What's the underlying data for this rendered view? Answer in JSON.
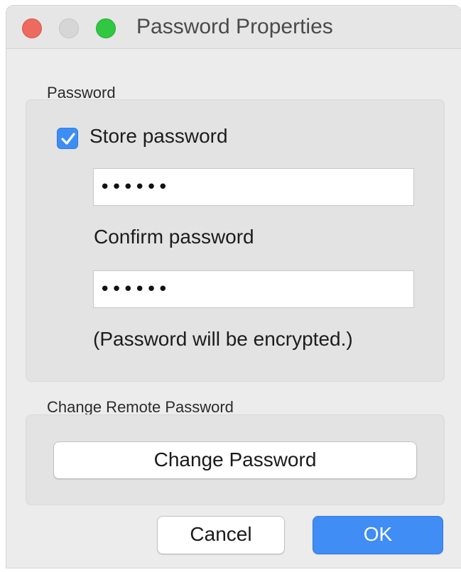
{
  "window": {
    "title": "Password Properties"
  },
  "password_group": {
    "label": "Password",
    "store_password": {
      "label": "Store password",
      "checked": true
    },
    "password_field": {
      "value": "••••••"
    },
    "confirm_label": "Confirm password",
    "confirm_field": {
      "value": "••••••"
    },
    "note": "(Password will be encrypted.)"
  },
  "remote_group": {
    "label": "Change Remote Password",
    "change_button": "Change Password"
  },
  "footer": {
    "cancel_button": "Cancel",
    "ok_button": "OK"
  },
  "colors": {
    "accent": "#3f8df5",
    "close": "#ed6a5e",
    "minimize": "#d6d6d6",
    "zoom": "#2fc840"
  }
}
